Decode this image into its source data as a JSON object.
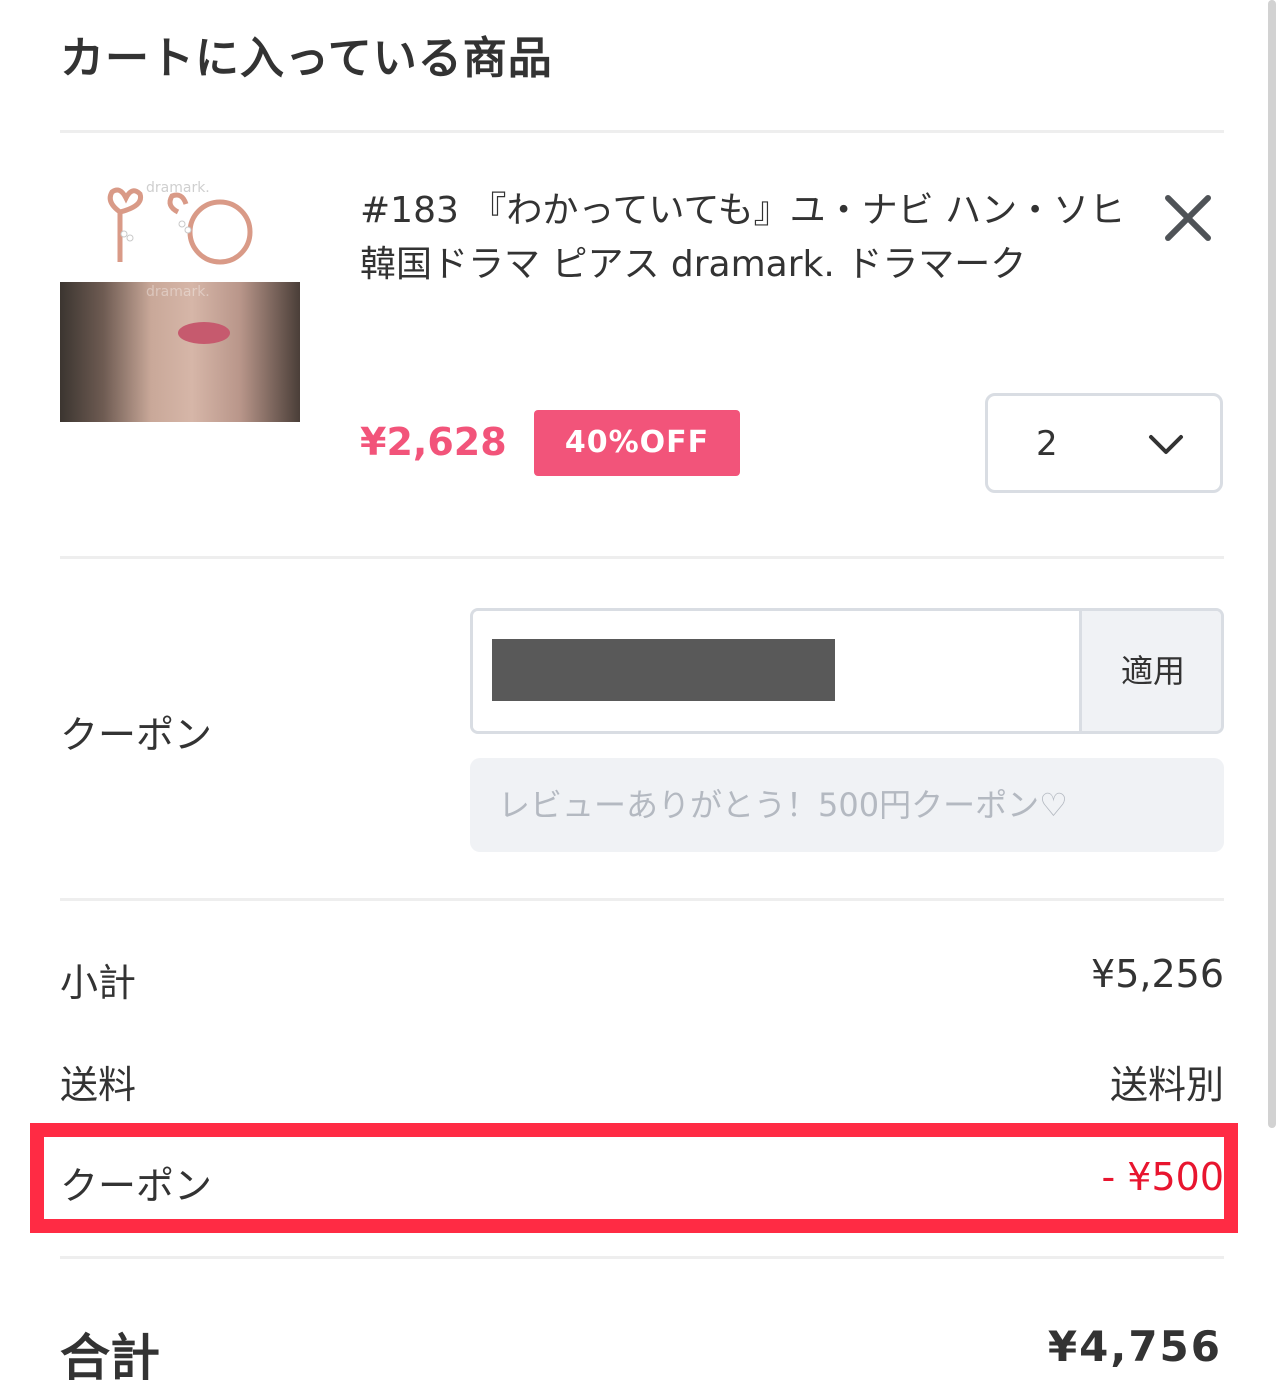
{
  "header": {
    "title": "カートに入っている商品"
  },
  "product": {
    "image_watermark": "dramark.",
    "title": "#183 『わかっていても』ユ・ナビ ハン・ソヒ 韓国ドラマ ピアス dramark. ドラマーク",
    "price": "¥2,628",
    "discount_badge": "40%OFF",
    "quantity": "2",
    "close_icon": "close-icon",
    "chevron_icon": "chevron-down-icon"
  },
  "coupon": {
    "label": "クーポン",
    "code_value": "",
    "apply_label": "適用",
    "applied_coupon": "レビューありがとう！500円クーポン♡"
  },
  "summary": {
    "subtotal_label": "小計",
    "subtotal_value": "¥5,256",
    "shipping_label": "送料",
    "shipping_value": "送料別",
    "coupon_label": "クーポン",
    "coupon_value": "- ¥500",
    "total_label": "合計",
    "total_value": "¥4,756"
  },
  "colors": {
    "accent_pink": "#f2547a",
    "discount_red": "#e8152f",
    "highlight_red": "#ff2b44"
  }
}
